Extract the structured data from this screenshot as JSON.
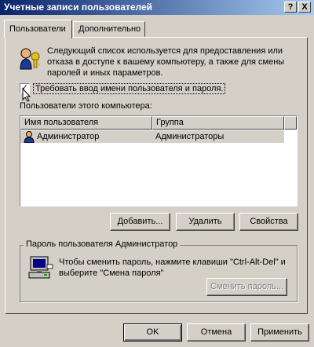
{
  "window": {
    "title": "Учетные записи пользователей",
    "help_button": "?",
    "close_button": "X"
  },
  "tabs": [
    {
      "label": "Пользователи",
      "active": true
    },
    {
      "label": "Дополнительно",
      "active": false
    }
  ],
  "info": {
    "text": "Следующий список используется для предоставления или отказа в доступе к вашему компьютеру, а также для смены паролей и иных параметров."
  },
  "require_login": {
    "label": "Требовать ввод имени пользователя и пароля.",
    "checked": true
  },
  "users": {
    "label": "Пользователи этого компьютера:",
    "columns": [
      "Имя пользователя",
      "Группа"
    ],
    "rows": [
      {
        "name": "Администратор",
        "group": "Администраторы"
      }
    ]
  },
  "list_buttons": {
    "add": "Добавить...",
    "remove": "Удалить",
    "properties": "Свойства"
  },
  "password_group": {
    "title": "Пароль пользователя Администратор",
    "text": "Чтобы сменить пароль, нажмите клавиши \"Ctrl-Alt-Del\" и выберите \"Смена пароля\"",
    "change_button": "Сменить пароль..."
  },
  "dialog_buttons": {
    "ok": "OK",
    "cancel": "Отмена",
    "apply": "Применить"
  }
}
